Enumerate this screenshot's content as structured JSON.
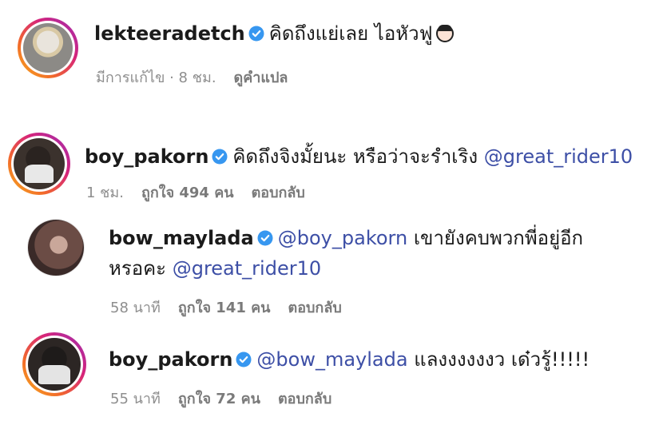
{
  "comments": [
    {
      "username": "lekteeradetch",
      "text": "คิดถึงแย่เลย ไอหัวฟู",
      "emoji": "woman-emoji",
      "meta": {
        "time": "มีการแก้ไข · 8 ชม.",
        "translate": "ดูคำแปล"
      }
    },
    {
      "username": "boy_pakorn",
      "text": "คิดถึงจิงมั้ยนะ หรือว่าจะรำเริง",
      "mention": "@great_rider10",
      "meta": {
        "time": "1 ชม.",
        "likes": "ถูกใจ 494 คน",
        "reply": "ตอบกลับ"
      }
    },
    {
      "username": "bow_maylada",
      "mention": "@boy_pakorn",
      "text": "เขายังคบพวกพี่อยู่อีก",
      "text2": "หรอคะ",
      "mention2": "@great_rider10",
      "meta": {
        "time": "58 นาที",
        "likes": "ถูกใจ 141 คน",
        "reply": "ตอบกลับ"
      }
    },
    {
      "username": "boy_pakorn",
      "mention": "@bow_maylada",
      "text": "แลงงงงงงว เด๋วรู้!!!!!",
      "meta": {
        "time": "55 นาที",
        "likes": "ถูกใจ 72 คน",
        "reply": "ตอบกลับ"
      }
    }
  ],
  "icons": {
    "verified": "verified-badge-icon",
    "verified_color": "#3797f0"
  }
}
